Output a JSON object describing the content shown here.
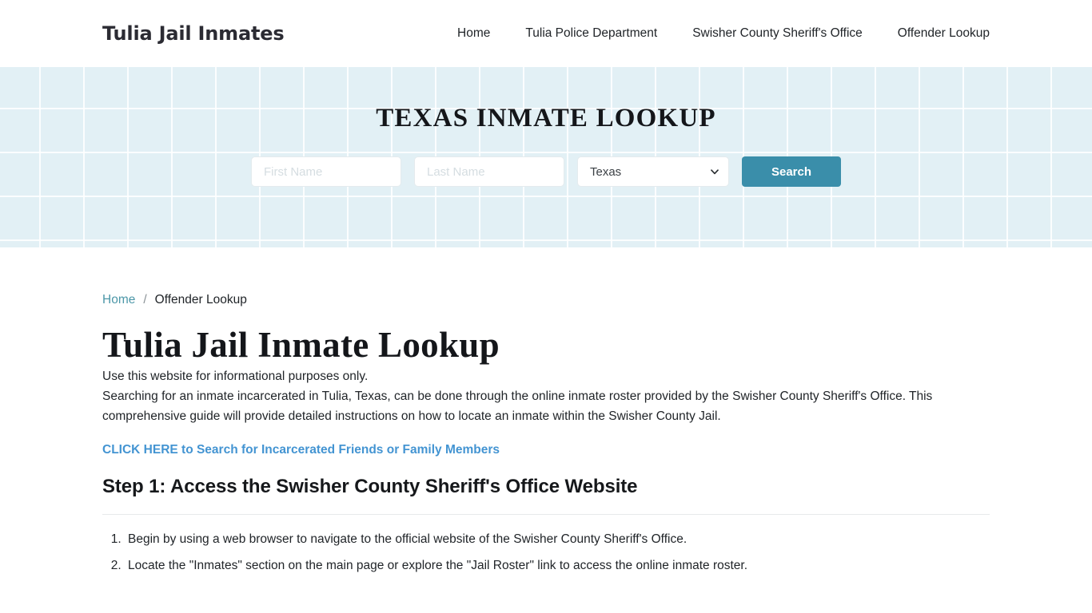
{
  "header": {
    "brand": "Tulia Jail Inmates",
    "nav": [
      {
        "label": "Home"
      },
      {
        "label": "Tulia Police Department"
      },
      {
        "label": "Swisher County Sheriff's Office"
      },
      {
        "label": "Offender Lookup"
      }
    ]
  },
  "hero": {
    "title": "TEXAS INMATE LOOKUP",
    "first_name": {
      "value": "",
      "placeholder": "First Name"
    },
    "last_name": {
      "value": "",
      "placeholder": "Last Name"
    },
    "state_select": {
      "selected": "Texas",
      "options": [
        "Texas"
      ]
    },
    "search_label": "Search",
    "accent_color": "#3a8eaa",
    "background_color": "#e2f0f5"
  },
  "breadcrumb": {
    "home": "Home",
    "separator": "/",
    "current": "Offender Lookup"
  },
  "main": {
    "page_title": "Tulia Jail Inmate Lookup",
    "intro": "Use this website for informational purposes only.",
    "paragraph": "Searching for an inmate incarcerated in Tulia, Texas, can be done through the online inmate roster provided by the Swisher County Sheriff's Office. This comprehensive guide will provide detailed instructions on how to locate an inmate within the Swisher County Jail.",
    "cta": "CLICK HERE to Search for Incarcerated Friends or Family Members",
    "cta_color": "#4394d2",
    "step_title": "Step 1: Access the Swisher County Sheriff's Office Website",
    "steps": [
      "Begin by using a web browser to navigate to the official website of the Swisher County Sheriff's Office.",
      "Locate the \"Inmates\" section on the main page or explore the \"Jail Roster\" link to access the online inmate roster."
    ]
  }
}
